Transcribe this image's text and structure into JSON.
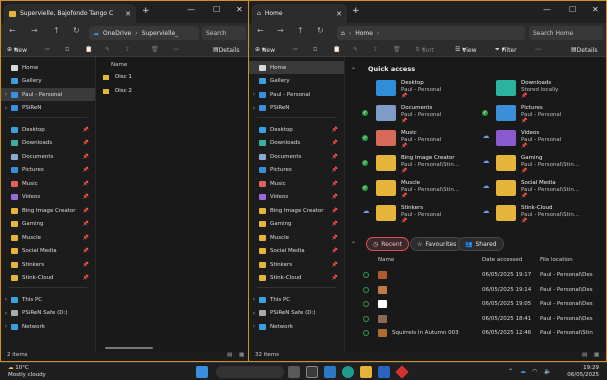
{
  "left": {
    "tab_title": "Supervielle, Bajofondo Tango C",
    "address": "OneDrive",
    "address2": "Supervielle_",
    "search": "Search",
    "cmd": {
      "new": "New",
      "details": "Details"
    },
    "sidebar": [
      {
        "label": "Home",
        "icon": "home-icon",
        "color": "#d8d8d8"
      },
      {
        "label": "Gallery",
        "icon": "gallery-icon",
        "color": "#3aa0e0"
      },
      {
        "label": "Paul - Personal",
        "icon": "cloud-icon",
        "color": "#3a8fe0",
        "chev": true,
        "selected": true
      },
      {
        "label": "PSiReN",
        "icon": "cloud-icon",
        "color": "#3a8fe0",
        "chev": true
      },
      {
        "label": "Desktop",
        "icon": "desktop-icon",
        "color": "#3aa0e0",
        "pin": true
      },
      {
        "label": "Downloads",
        "icon": "downloads-icon",
        "color": "#3ab0a0",
        "pin": true
      },
      {
        "label": "Documents",
        "icon": "documents-icon",
        "color": "#8aa8d0",
        "pin": true
      },
      {
        "label": "Pictures",
        "icon": "pictures-icon",
        "color": "#3a90d8",
        "pin": true
      },
      {
        "label": "Music",
        "icon": "music-icon",
        "color": "#e06060",
        "pin": true
      },
      {
        "label": "Videos",
        "icon": "videos-icon",
        "color": "#9a6ad8",
        "pin": true
      },
      {
        "label": "Bing Image Creator",
        "icon": "folder-icon",
        "color": "#e5b43a",
        "pin": true
      },
      {
        "label": "Gaming",
        "icon": "folder-icon",
        "color": "#e5b43a",
        "pin": true
      },
      {
        "label": "Muscle",
        "icon": "folder-icon",
        "color": "#e5b43a",
        "pin": true
      },
      {
        "label": "Social Media",
        "icon": "folder-icon",
        "color": "#e5b43a",
        "pin": true
      },
      {
        "label": "Stinkers",
        "icon": "folder-icon",
        "color": "#e5b43a",
        "pin": true
      },
      {
        "label": "Stink-Cloud",
        "icon": "folder-icon",
        "color": "#e5b43a",
        "pin": true
      },
      {
        "label": "This PC",
        "icon": "pc-icon",
        "color": "#3aa0e0",
        "chev": true
      },
      {
        "label": "PSiReN Safe (D:)",
        "icon": "drive-icon",
        "color": "#aaaaaa",
        "chev": true
      },
      {
        "label": "Network",
        "icon": "network-icon",
        "color": "#3aa0e0",
        "chev": true
      }
    ],
    "name_header": "Name",
    "files": [
      "Disc 1",
      "Disc 2"
    ],
    "status": "2 items"
  },
  "right": {
    "tab_title": "Home",
    "address": "Home",
    "search": "Search Home",
    "cmd": {
      "new": "New",
      "sort": "Sort",
      "view": "View",
      "filter": "Filter",
      "details": "Details"
    },
    "sidebar": [
      {
        "label": "Home",
        "icon": "home-icon",
        "color": "#d8d8d8",
        "selected": true
      },
      {
        "label": "Gallery",
        "icon": "gallery-icon",
        "color": "#3aa0e0"
      },
      {
        "label": "Paul - Personal",
        "icon": "cloud-icon",
        "color": "#3a8fe0",
        "chev": true
      },
      {
        "label": "PSiReN",
        "icon": "cloud-icon",
        "color": "#3a8fe0",
        "chev": true
      },
      {
        "label": "Desktop",
        "icon": "desktop-icon",
        "color": "#3aa0e0",
        "pin": true
      },
      {
        "label": "Downloads",
        "icon": "downloads-icon",
        "color": "#3ab0a0",
        "pin": true
      },
      {
        "label": "Documents",
        "icon": "documents-icon",
        "color": "#8aa8d0",
        "pin": true
      },
      {
        "label": "Pictures",
        "icon": "pictures-icon",
        "color": "#3a90d8",
        "pin": true
      },
      {
        "label": "Music",
        "icon": "music-icon",
        "color": "#e06060",
        "pin": true
      },
      {
        "label": "Videos",
        "icon": "videos-icon",
        "color": "#9a6ad8",
        "pin": true
      },
      {
        "label": "Bing Image Creator",
        "icon": "folder-icon",
        "color": "#e5b43a",
        "pin": true
      },
      {
        "label": "Gaming",
        "icon": "folder-icon",
        "color": "#e5b43a",
        "pin": true
      },
      {
        "label": "Muscle",
        "icon": "folder-icon",
        "color": "#e5b43a",
        "pin": true
      },
      {
        "label": "Social Media",
        "icon": "folder-icon",
        "color": "#e5b43a",
        "pin": true
      },
      {
        "label": "Stinkers",
        "icon": "folder-icon",
        "color": "#e5b43a",
        "pin": true
      },
      {
        "label": "Stink-Cloud",
        "icon": "folder-icon",
        "color": "#e5b43a",
        "pin": true
      },
      {
        "label": "This PC",
        "icon": "pc-icon",
        "color": "#3aa0e0",
        "chev": true
      },
      {
        "label": "PSiReN Safe (D:)",
        "icon": "drive-icon",
        "color": "#aaaaaa",
        "chev": true
      },
      {
        "label": "Network",
        "icon": "network-icon",
        "color": "#3aa0e0",
        "chev": true
      }
    ],
    "quick_access_title": "Quick access",
    "quick_access": [
      {
        "name": "Desktop",
        "sub": "Paul - Personal",
        "color": "#2f8fd8",
        "status": "none"
      },
      {
        "name": "Downloads",
        "sub": "Stored locally",
        "color": "#2bb3a0",
        "status": "none"
      },
      {
        "name": "Documents",
        "sub": "Paul - Personal",
        "color": "#7f9cc4",
        "status": "ok"
      },
      {
        "name": "Pictures",
        "sub": "Paul - Personal",
        "color": "#3a8fd8",
        "status": "ok"
      },
      {
        "name": "Music",
        "sub": "Paul - Personal",
        "color": "#d86a5a",
        "status": "ok"
      },
      {
        "name": "Videos",
        "sub": "Paul - Personal",
        "color": "#8a5ad0",
        "status": "cloud"
      },
      {
        "name": "Bing Image Creator",
        "sub": "Paul - Personal\\Stin...",
        "color": "#e5b43a",
        "status": "ok"
      },
      {
        "name": "Gaming",
        "sub": "Paul - Personal\\Stin...",
        "color": "#e5b43a",
        "status": "cloud"
      },
      {
        "name": "Muscle",
        "sub": "Paul - Personal\\Stin...",
        "color": "#e5b43a",
        "status": "ok"
      },
      {
        "name": "Social Media",
        "sub": "Paul - Personal\\Stin...",
        "color": "#e5b43a",
        "status": "cloud"
      },
      {
        "name": "Stinkers",
        "sub": "Paul - Personal",
        "color": "#e5b43a",
        "status": "cloud"
      },
      {
        "name": "Stink-Cloud",
        "sub": "Paul - Personal\\Stin...",
        "color": "#e5b43a",
        "status": "cloud"
      }
    ],
    "tabs": {
      "recent": "Recent",
      "favourites": "Favourites",
      "shared": "Shared"
    },
    "columns": {
      "name": "Name",
      "date": "Date accessed",
      "location": "File location"
    },
    "recent": [
      {
        "name": "",
        "date": "06/05/2025 19:17",
        "loc": "Paul - Personal\\Des",
        "color": "#b05a30"
      },
      {
        "name": "",
        "date": "06/05/2025 19:14",
        "loc": "Paul - Personal\\Des",
        "color": "#c07a40"
      },
      {
        "name": "",
        "date": "06/05/2025 19:05",
        "loc": "Paul - Personal\\Des",
        "color": "#ffffff"
      },
      {
        "name": "",
        "date": "06/05/2025 18:41",
        "loc": "Paul - Personal\\Des",
        "color": "#8a6a50"
      },
      {
        "name": "Squirrels In Autumn 003",
        "date": "06/05/2025 12:46",
        "loc": "Paul - Personal\\Stin",
        "color": "#b06a30"
      }
    ],
    "status": "32 items"
  },
  "taskbar": {
    "temp": "10°C",
    "weather": "Mostly cloudy",
    "time": "19:29",
    "date": "06/05/2025"
  }
}
